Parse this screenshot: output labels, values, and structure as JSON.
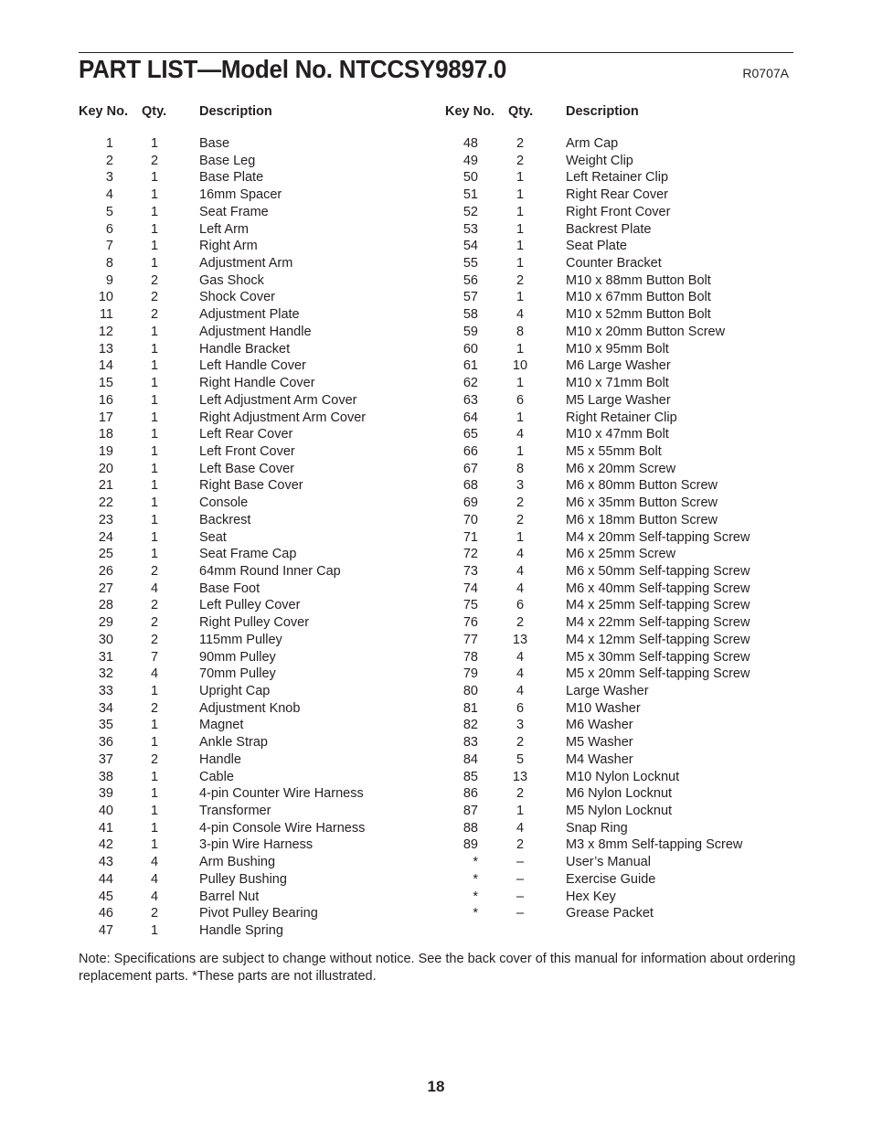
{
  "header": {
    "title": "PART LIST—Model No. NTCCSY9897.0",
    "doc_code": "R0707A"
  },
  "columns": {
    "key_label": "Key No.",
    "qty_label": "Qty.",
    "desc_label": "Description"
  },
  "parts_left": [
    {
      "key": "1",
      "qty": "1",
      "desc": "Base"
    },
    {
      "key": "2",
      "qty": "2",
      "desc": "Base Leg"
    },
    {
      "key": "3",
      "qty": "1",
      "desc": "Base Plate"
    },
    {
      "key": "4",
      "qty": "1",
      "desc": "16mm Spacer"
    },
    {
      "key": "5",
      "qty": "1",
      "desc": "Seat Frame"
    },
    {
      "key": "6",
      "qty": "1",
      "desc": "Left Arm"
    },
    {
      "key": "7",
      "qty": "1",
      "desc": "Right Arm"
    },
    {
      "key": "8",
      "qty": "1",
      "desc": "Adjustment Arm"
    },
    {
      "key": "9",
      "qty": "2",
      "desc": "Gas Shock"
    },
    {
      "key": "10",
      "qty": "2",
      "desc": "Shock Cover"
    },
    {
      "key": "11",
      "qty": "2",
      "desc": "Adjustment Plate"
    },
    {
      "key": "12",
      "qty": "1",
      "desc": "Adjustment Handle"
    },
    {
      "key": "13",
      "qty": "1",
      "desc": "Handle Bracket"
    },
    {
      "key": "14",
      "qty": "1",
      "desc": "Left Handle Cover"
    },
    {
      "key": "15",
      "qty": "1",
      "desc": "Right Handle Cover"
    },
    {
      "key": "16",
      "qty": "1",
      "desc": "Left Adjustment Arm Cover"
    },
    {
      "key": "17",
      "qty": "1",
      "desc": "Right Adjustment Arm Cover"
    },
    {
      "key": "18",
      "qty": "1",
      "desc": "Left Rear Cover"
    },
    {
      "key": "19",
      "qty": "1",
      "desc": "Left Front Cover"
    },
    {
      "key": "20",
      "qty": "1",
      "desc": "Left Base Cover"
    },
    {
      "key": "21",
      "qty": "1",
      "desc": "Right Base Cover"
    },
    {
      "key": "22",
      "qty": "1",
      "desc": "Console"
    },
    {
      "key": "23",
      "qty": "1",
      "desc": "Backrest"
    },
    {
      "key": "24",
      "qty": "1",
      "desc": "Seat"
    },
    {
      "key": "25",
      "qty": "1",
      "desc": "Seat Frame Cap"
    },
    {
      "key": "26",
      "qty": "2",
      "desc": "64mm Round Inner Cap"
    },
    {
      "key": "27",
      "qty": "4",
      "desc": "Base Foot"
    },
    {
      "key": "28",
      "qty": "2",
      "desc": "Left Pulley Cover"
    },
    {
      "key": "29",
      "qty": "2",
      "desc": "Right Pulley Cover"
    },
    {
      "key": "30",
      "qty": "2",
      "desc": "115mm Pulley"
    },
    {
      "key": "31",
      "qty": "7",
      "desc": "90mm Pulley"
    },
    {
      "key": "32",
      "qty": "4",
      "desc": "70mm Pulley"
    },
    {
      "key": "33",
      "qty": "1",
      "desc": "Upright Cap"
    },
    {
      "key": "34",
      "qty": "2",
      "desc": "Adjustment Knob"
    },
    {
      "key": "35",
      "qty": "1",
      "desc": "Magnet"
    },
    {
      "key": "36",
      "qty": "1",
      "desc": "Ankle Strap"
    },
    {
      "key": "37",
      "qty": "2",
      "desc": "Handle"
    },
    {
      "key": "38",
      "qty": "1",
      "desc": "Cable"
    },
    {
      "key": "39",
      "qty": "1",
      "desc": "4-pin Counter Wire Harness"
    },
    {
      "key": "40",
      "qty": "1",
      "desc": "Transformer"
    },
    {
      "key": "41",
      "qty": "1",
      "desc": "4-pin Console Wire Harness"
    },
    {
      "key": "42",
      "qty": "1",
      "desc": "3-pin Wire Harness"
    },
    {
      "key": "43",
      "qty": "4",
      "desc": "Arm Bushing"
    },
    {
      "key": "44",
      "qty": "4",
      "desc": "Pulley Bushing"
    },
    {
      "key": "45",
      "qty": "4",
      "desc": "Barrel Nut"
    },
    {
      "key": "46",
      "qty": "2",
      "desc": "Pivot Pulley Bearing"
    },
    {
      "key": "47",
      "qty": "1",
      "desc": "Handle Spring"
    }
  ],
  "parts_right": [
    {
      "key": "48",
      "qty": "2",
      "desc": "Arm Cap"
    },
    {
      "key": "49",
      "qty": "2",
      "desc": "Weight Clip"
    },
    {
      "key": "50",
      "qty": "1",
      "desc": "Left Retainer Clip"
    },
    {
      "key": "51",
      "qty": "1",
      "desc": "Right Rear Cover"
    },
    {
      "key": "52",
      "qty": "1",
      "desc": "Right Front Cover"
    },
    {
      "key": "53",
      "qty": "1",
      "desc": "Backrest Plate"
    },
    {
      "key": "54",
      "qty": "1",
      "desc": "Seat Plate"
    },
    {
      "key": "55",
      "qty": "1",
      "desc": "Counter Bracket"
    },
    {
      "key": "56",
      "qty": "2",
      "desc": "M10 x 88mm Button Bolt"
    },
    {
      "key": "57",
      "qty": "1",
      "desc": "M10 x 67mm Button Bolt"
    },
    {
      "key": "58",
      "qty": "4",
      "desc": "M10 x 52mm Button Bolt"
    },
    {
      "key": "59",
      "qty": "8",
      "desc": "M10 x 20mm Button Screw"
    },
    {
      "key": "60",
      "qty": "1",
      "desc": "M10 x 95mm Bolt"
    },
    {
      "key": "61",
      "qty": "10",
      "desc": "M6 Large Washer"
    },
    {
      "key": "62",
      "qty": "1",
      "desc": "M10 x 71mm Bolt"
    },
    {
      "key": "63",
      "qty": "6",
      "desc": "M5 Large Washer"
    },
    {
      "key": "64",
      "qty": "1",
      "desc": "Right Retainer Clip"
    },
    {
      "key": "65",
      "qty": "4",
      "desc": "M10 x 47mm Bolt"
    },
    {
      "key": "66",
      "qty": "1",
      "desc": "M5 x 55mm Bolt"
    },
    {
      "key": "67",
      "qty": "8",
      "desc": "M6 x 20mm Screw"
    },
    {
      "key": "68",
      "qty": "3",
      "desc": "M6 x 80mm Button Screw"
    },
    {
      "key": "69",
      "qty": "2",
      "desc": "M6 x 35mm Button Screw"
    },
    {
      "key": "70",
      "qty": "2",
      "desc": "M6 x 18mm Button Screw"
    },
    {
      "key": "71",
      "qty": "1",
      "desc": "M4 x 20mm Self-tapping Screw"
    },
    {
      "key": "72",
      "qty": "4",
      "desc": "M6 x 25mm Screw"
    },
    {
      "key": "73",
      "qty": "4",
      "desc": "M6 x 50mm Self-tapping Screw"
    },
    {
      "key": "74",
      "qty": "4",
      "desc": "M6 x 40mm Self-tapping Screw"
    },
    {
      "key": "75",
      "qty": "6",
      "desc": "M4 x 25mm Self-tapping Screw"
    },
    {
      "key": "76",
      "qty": "2",
      "desc": "M4 x 22mm Self-tapping Screw"
    },
    {
      "key": "77",
      "qty": "13",
      "desc": "M4 x 12mm Self-tapping Screw"
    },
    {
      "key": "78",
      "qty": "4",
      "desc": "M5 x 30mm Self-tapping Screw"
    },
    {
      "key": "79",
      "qty": "4",
      "desc": "M5 x 20mm Self-tapping Screw"
    },
    {
      "key": "80",
      "qty": "4",
      "desc": "Large Washer"
    },
    {
      "key": "81",
      "qty": "6",
      "desc": "M10 Washer"
    },
    {
      "key": "82",
      "qty": "3",
      "desc": "M6 Washer"
    },
    {
      "key": "83",
      "qty": "2",
      "desc": "M5 Washer"
    },
    {
      "key": "84",
      "qty": "5",
      "desc": "M4 Washer"
    },
    {
      "key": "85",
      "qty": "13",
      "desc": "M10 Nylon Locknut"
    },
    {
      "key": "86",
      "qty": "2",
      "desc": "M6 Nylon Locknut"
    },
    {
      "key": "87",
      "qty": "1",
      "desc": "M5 Nylon Locknut"
    },
    {
      "key": "88",
      "qty": "4",
      "desc": "Snap Ring"
    },
    {
      "key": "89",
      "qty": "2",
      "desc": "M3 x 8mm Self-tapping Screw"
    },
    {
      "key": "*",
      "qty": "–",
      "desc": "User’s Manual"
    },
    {
      "key": "*",
      "qty": "–",
      "desc": "Exercise Guide"
    },
    {
      "key": "*",
      "qty": "–",
      "desc": "Hex Key"
    },
    {
      "key": "*",
      "qty": "–",
      "desc": "Grease Packet"
    }
  ],
  "note": "Note: Specifications are subject to change without notice. See the back cover of this manual for information about ordering replacement parts. *These parts are not illustrated.",
  "page_number": "18"
}
